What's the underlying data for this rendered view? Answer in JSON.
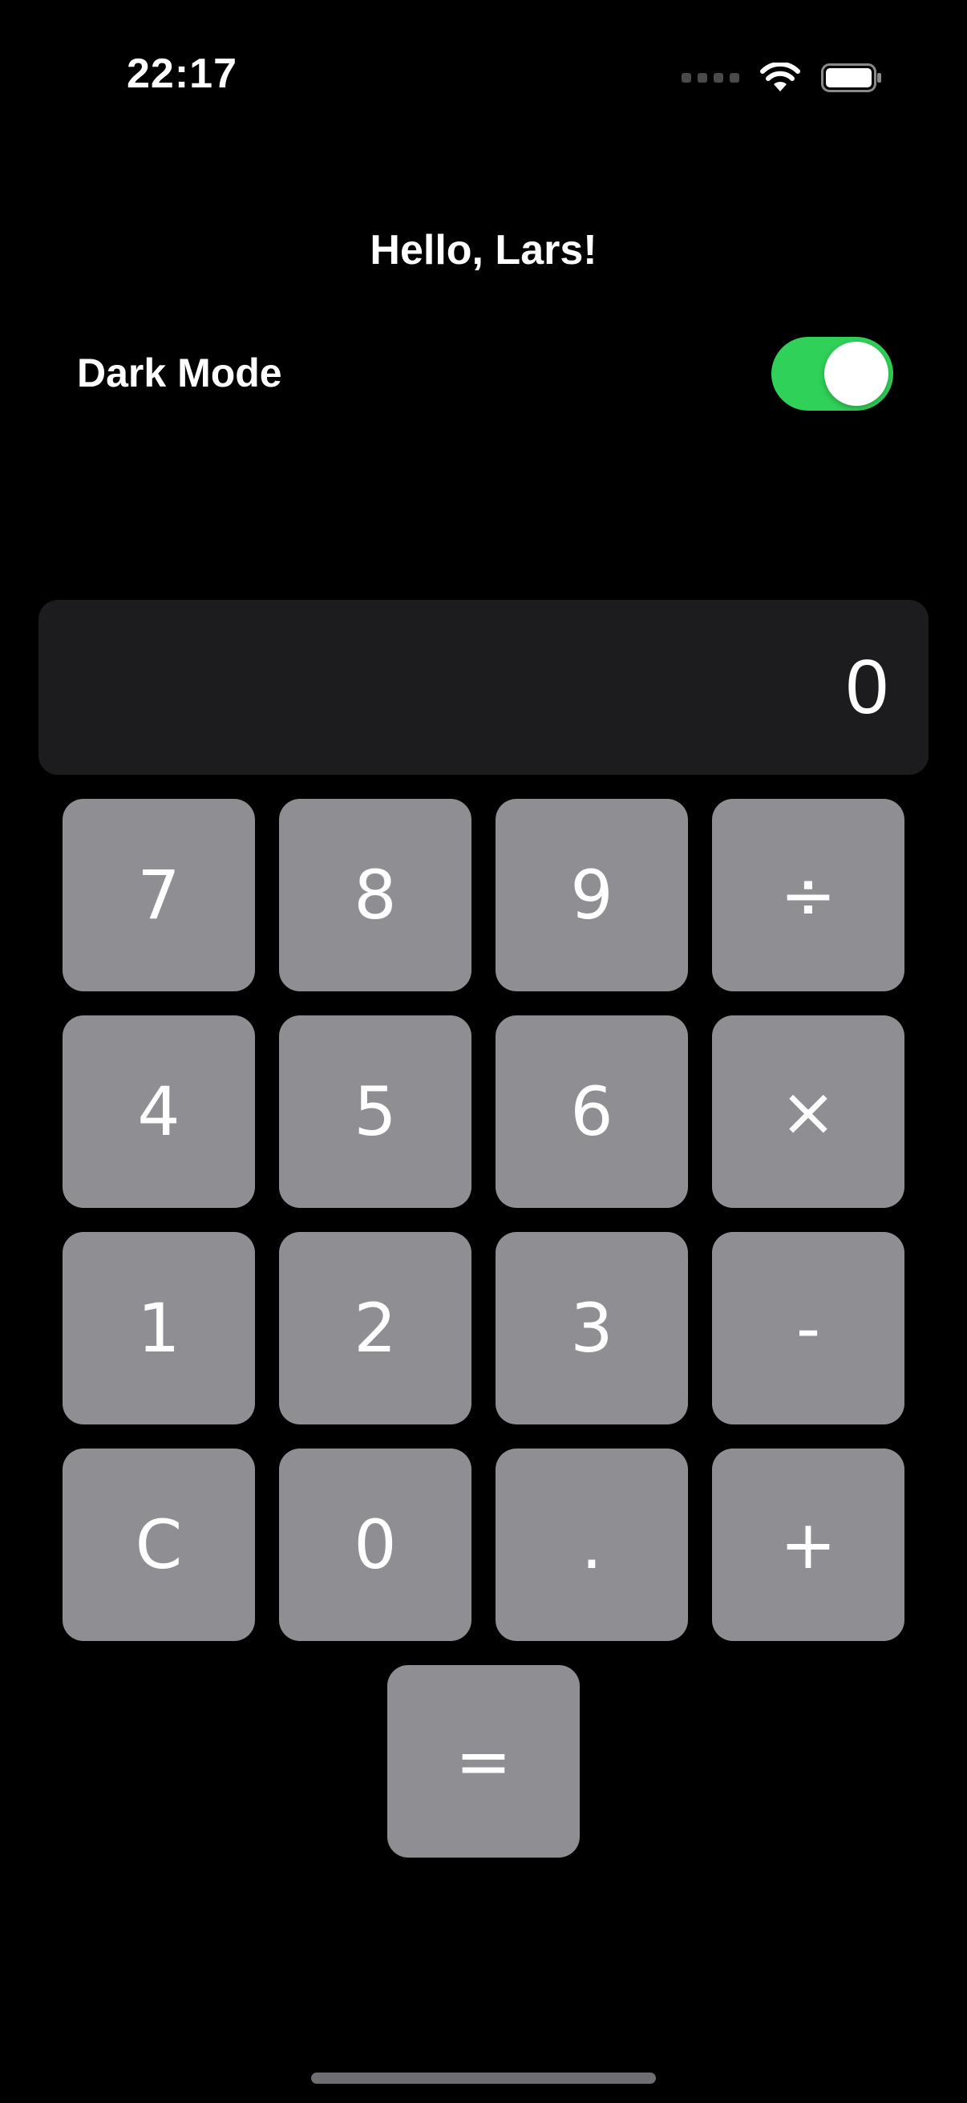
{
  "status_bar": {
    "time": "22:17"
  },
  "greeting": "Hello, Lars!",
  "dark_mode": {
    "label": "Dark Mode",
    "on": true
  },
  "display": {
    "value": "0"
  },
  "keypad": {
    "k7": "7",
    "k8": "8",
    "k9": "9",
    "divide": "÷",
    "k4": "4",
    "k5": "5",
    "k6": "6",
    "multiply": "×",
    "k1": "1",
    "k2": "2",
    "k3": "3",
    "minus": "-",
    "clear": "C",
    "k0": "0",
    "decimal": ".",
    "plus": "+",
    "equals": "="
  },
  "colors": {
    "background": "#000000",
    "display_bg": "#1c1c1e",
    "key_bg": "#8e8e93",
    "toggle_on": "#30d158"
  }
}
